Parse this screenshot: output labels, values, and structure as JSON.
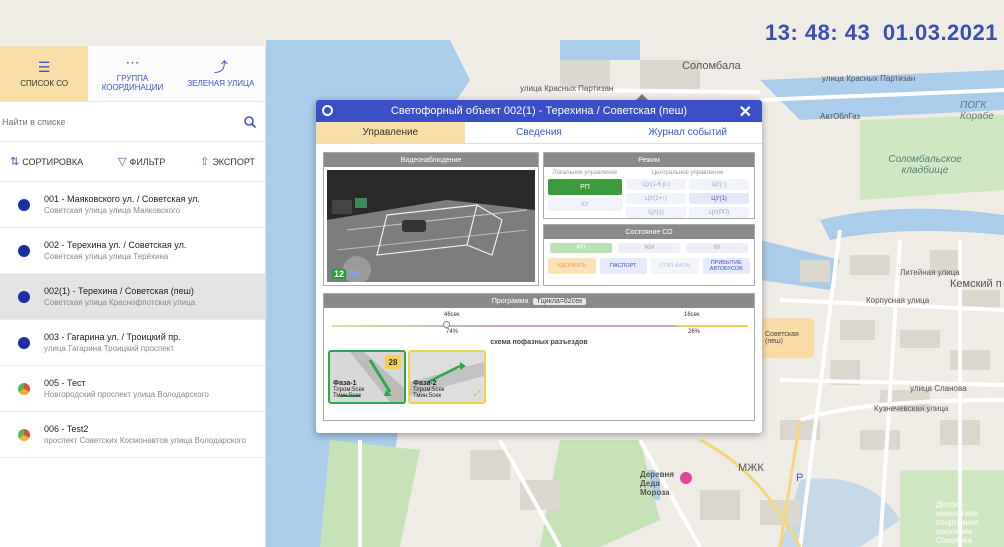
{
  "clock": {
    "time": "13: 48: 43",
    "date": "01.03.2021"
  },
  "colors": {
    "accent": "#3b4fc8",
    "active_tab": "#f8dfa8",
    "green": "#3c9c3c",
    "dot": "#1b2fa0"
  },
  "map": {
    "labels": {
      "solombala": "Соломбала",
      "ul_krasnykh_partizan_1": "улица Красных Партизан",
      "ul_krasnykh_partizan_2": "улица Красных Партизан",
      "pogk": "ПОГК",
      "korabe": "Корабе",
      "avtoobl": "АвтОблГаз",
      "cemetery": "Соломбальское кладбище",
      "liteynaya": "Литейная улица",
      "kemskiy": "Кемский п",
      "korpusnaya": "Корпусная улица",
      "slanova": "улица Сланова",
      "kuznechevskaya": "Кузнечевская улица",
      "ded_moroz": "Деревня Деда Мороза",
      "mzhk": "МЖК",
      "p": "P",
      "sport_school": "Детско-юношеская спортивная школа им. Соколова",
      "sovetskaya_tooltip": "Советская (пеш)",
      "unnamed_street": "Советская улица"
    }
  },
  "sidebar": {
    "tabs": [
      {
        "label": "СПИСОК СО",
        "icon": "list-icon"
      },
      {
        "label": "ГРУППА КООРДИНАЦИИ",
        "icon": "group-icon"
      },
      {
        "label": "ЗЕЛЕНАЯ УЛИЦА",
        "icon": "route-icon"
      }
    ],
    "search": {
      "placeholder": "Найти в списке",
      "value": ""
    },
    "tools": {
      "sort": "СОРТИРОВКА",
      "filter": "ФИЛЬТР",
      "export": "ЭКСПОРТ"
    },
    "items": [
      {
        "title": "001 - Маяковского ул. / Советская ул.",
        "sub": "Советская улица улица Маяковского",
        "dot": "single"
      },
      {
        "title": "002 - Терехина ул. / Советская ул.",
        "sub": "Советская улица улица Терёхина",
        "dot": "single"
      },
      {
        "title": "002(1) - Терехина / Советская (пеш)",
        "sub": "Советская улица Краснофлотская улица",
        "dot": "single",
        "selected": true
      },
      {
        "title": "003 - Гагарина ул. / Троицкий пр.",
        "sub": "улица Гагарина Троицкий проспект",
        "dot": "single"
      },
      {
        "title": "005 - Тест",
        "sub": "Новгородский проспект улица Володарского",
        "dot": "multi"
      },
      {
        "title": "006 - Test2",
        "sub": "проспект Советских Космонавтов улица Володарского",
        "dot": "multi"
      }
    ]
  },
  "modal": {
    "title": "Светофорный объект 002(1) - Терехина / Советская (пеш)",
    "tabs": [
      "Управление",
      "Сведения",
      "Журнал событий"
    ],
    "video": {
      "title": "Видеонаблюдение",
      "cam_left": "12",
      "cam_right": "88"
    },
    "mode": {
      "title": "Режим",
      "local_caption": "Локальное управление",
      "central_caption": "Центральное управление",
      "rp": "РП",
      "ku": "КУ",
      "central_buttons": [
        "ЦУ(1-6 р.)",
        "ЦУ(↑)",
        "ЦУ(1+↑)",
        "ЦУ(1)",
        "ЦУ(1)",
        "ЦУ(РП)"
      ]
    },
    "state": {
      "title": "Состояние СО",
      "pills": [
        "РП",
        "ЖМ",
        "КК"
      ],
      "buttons": [
        "УДЕРЖАТЬ",
        "ПАСПОРТ",
        "ОТКЛ.ФАЗЫ",
        "ПРИБЫТИЕ АВТОБУСОВ"
      ]
    },
    "program": {
      "title": "Программа",
      "cycle": "Тцикла=62сек",
      "seg1_time": "46сек",
      "seg1_pct": "74%",
      "seg2_time": "16сек",
      "seg2_pct": "26%",
      "schema": "схема пофазных разъездов",
      "phases": [
        {
          "name": "Фаза-1",
          "tprom": "Тпром:5сек",
          "tmin": "Тмин:5сек",
          "badge": "28"
        },
        {
          "name": "Фаза-2",
          "tprom": "Тпром:5сек",
          "tmin": "Тмин:5сек"
        }
      ]
    }
  }
}
